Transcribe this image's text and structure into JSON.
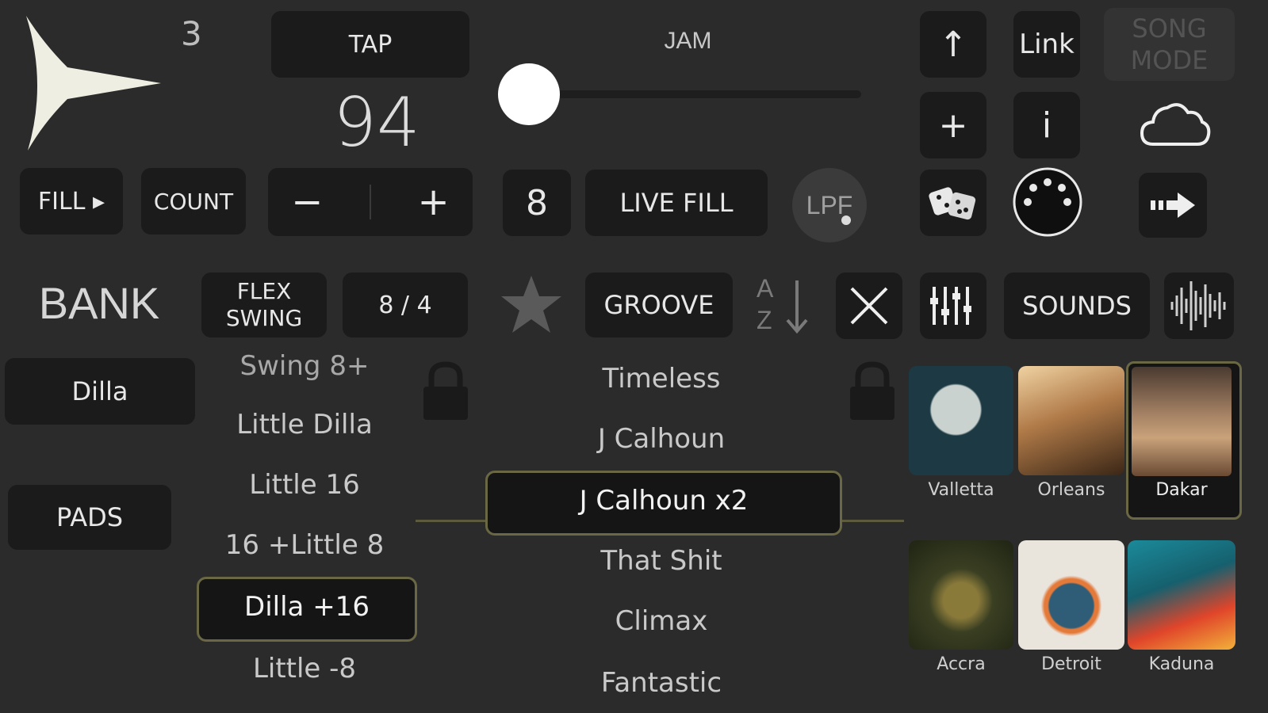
{
  "transport": {
    "bar_count": "3",
    "tap_label": "TAP",
    "bpm": "94",
    "fill_label": "FILL ▸",
    "count_label": "COUNT",
    "minus_label": "−",
    "plus_label": "+",
    "steps": "8",
    "live_fill_label": "LIVE FILL",
    "lpf_label": "LPF"
  },
  "jam": {
    "label": "JAM",
    "level": 0.0
  },
  "top_right": {
    "up_label": "↑",
    "link_label": "Link",
    "song_mode_line1": "SONG",
    "song_mode_line2": "MODE",
    "add_label": "+",
    "info_label": "i"
  },
  "row2": {
    "bank_label": "BANK",
    "flex_line1": "FLEX",
    "flex_line2": "SWING",
    "time_sig": "8 / 4",
    "groove_label": "GROOVE",
    "sort_a": "A",
    "sort_z": "Z",
    "sounds_label": "SOUNDS"
  },
  "side_buttons": {
    "dilla": "Dilla",
    "pads": "PADS"
  },
  "swing_list": [
    "Swing 8+",
    "Little Dilla",
    "Little 16",
    "16 +Little 8",
    "Dilla +16",
    "Little -8"
  ],
  "groove_list": [
    "Timeless",
    "J Calhoun",
    "J Calhoun x2",
    "That Shit",
    "Climax",
    "Fantastic"
  ],
  "kits": [
    {
      "name": "Valletta",
      "color1": "#1d3a44",
      "color2": "#c9d2cf"
    },
    {
      "name": "Orleans",
      "color1": "#6a4a2a",
      "color2": "#e9c79a"
    },
    {
      "name": "Dakar",
      "color1": "#3a2a22",
      "color2": "#c9a27a"
    },
    {
      "name": "Accra",
      "color1": "#2a2e1a",
      "color2": "#8a7a3a"
    },
    {
      "name": "Detroit",
      "color1": "#e9e4dc",
      "color2": "#2f5d78"
    },
    {
      "name": "Kaduna",
      "color1": "#16606e",
      "color2": "#e0452a"
    }
  ]
}
